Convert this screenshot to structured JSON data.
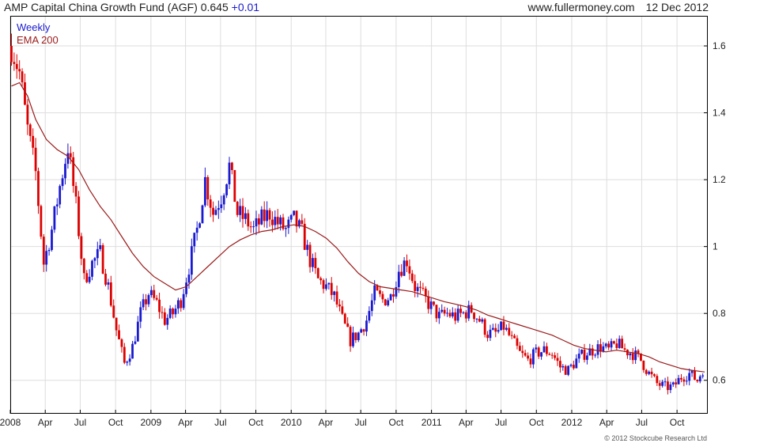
{
  "header": {
    "title": "AMP Capital China Growth Fund (AGF) 0.645",
    "change": "+0.01",
    "site": "www.fullermoney.com",
    "date": "12 Dec 2012"
  },
  "credit": "© 2012 Stockcube Research Ltd",
  "colors": {
    "up": "#1a1ad0",
    "down": "#dd0000",
    "ema": "#9a1a1a",
    "grid": "#dddddd",
    "axis": "#000000"
  },
  "chart_data": {
    "type": "candlestick",
    "frequency": "Weekly",
    "legend": [
      "Weekly",
      "EMA 200"
    ],
    "legend_position": "top-left",
    "grid": true,
    "x_ticks": [
      "2008",
      "Apr",
      "Jul",
      "Oct",
      "2009",
      "Apr",
      "Jul",
      "Oct",
      "2010",
      "Apr",
      "Jul",
      "Oct",
      "2011",
      "Apr",
      "Jul",
      "Oct",
      "2012",
      "Apr",
      "Jul",
      "Oct"
    ],
    "y_ticks": [
      "0.6",
      "0.8",
      "1",
      "1.2",
      "1.4",
      "1.6"
    ],
    "y_axis_side": "right",
    "ylim": [
      0.5,
      1.69
    ],
    "xlim": [
      "2008-01-01",
      "2012-12-20"
    ],
    "series": [
      {
        "name": "Weekly",
        "values": [
          [
            "2008-01-04",
            1.6
          ],
          [
            "2008-01-25",
            1.52
          ],
          [
            "2008-02-15",
            1.35
          ],
          [
            "2008-03-07",
            1.22
          ],
          [
            "2008-03-28",
            0.95
          ],
          [
            "2008-04-18",
            1.05
          ],
          [
            "2008-05-09",
            1.18
          ],
          [
            "2008-05-30",
            1.3
          ],
          [
            "2008-06-20",
            1.12
          ],
          [
            "2008-07-11",
            0.9
          ],
          [
            "2008-08-01",
            0.95
          ],
          [
            "2008-08-22",
            0.98
          ],
          [
            "2008-09-12",
            0.88
          ],
          [
            "2008-10-03",
            0.75
          ],
          [
            "2008-10-24",
            0.65
          ],
          [
            "2008-11-14",
            0.7
          ],
          [
            "2008-12-05",
            0.8
          ],
          [
            "2008-12-26",
            0.86
          ],
          [
            "2009-01-16",
            0.83
          ],
          [
            "2009-02-06",
            0.78
          ],
          [
            "2009-02-27",
            0.8
          ],
          [
            "2009-03-20",
            0.84
          ],
          [
            "2009-04-10",
            0.94
          ],
          [
            "2009-05-01",
            1.05
          ],
          [
            "2009-05-22",
            1.2
          ],
          [
            "2009-06-12",
            1.1
          ],
          [
            "2009-07-03",
            1.15
          ],
          [
            "2009-07-24",
            1.24
          ],
          [
            "2009-08-14",
            1.1
          ],
          [
            "2009-09-04",
            1.08
          ],
          [
            "2009-09-25",
            1.05
          ],
          [
            "2009-10-16",
            1.08
          ],
          [
            "2009-11-06",
            1.1
          ],
          [
            "2009-11-27",
            1.07
          ],
          [
            "2009-12-18",
            1.05
          ],
          [
            "2010-01-08",
            1.08
          ],
          [
            "2010-01-29",
            1.04
          ],
          [
            "2010-02-19",
            0.96
          ],
          [
            "2010-03-12",
            0.9
          ],
          [
            "2010-04-02",
            0.88
          ],
          [
            "2010-04-23",
            0.85
          ],
          [
            "2010-05-14",
            0.78
          ],
          [
            "2010-06-04",
            0.72
          ],
          [
            "2010-06-25",
            0.74
          ],
          [
            "2010-07-16",
            0.78
          ],
          [
            "2010-08-06",
            0.86
          ],
          [
            "2010-08-27",
            0.84
          ],
          [
            "2010-09-17",
            0.85
          ],
          [
            "2010-10-08",
            0.93
          ],
          [
            "2010-10-29",
            0.96
          ],
          [
            "2010-11-19",
            0.88
          ],
          [
            "2010-12-10",
            0.85
          ],
          [
            "2010-12-31",
            0.82
          ],
          [
            "2011-01-21",
            0.79
          ],
          [
            "2011-02-11",
            0.8
          ],
          [
            "2011-03-04",
            0.79
          ],
          [
            "2011-03-25",
            0.8
          ],
          [
            "2011-04-15",
            0.81
          ],
          [
            "2011-05-06",
            0.78
          ],
          [
            "2011-05-27",
            0.74
          ],
          [
            "2011-06-17",
            0.74
          ],
          [
            "2011-07-08",
            0.76
          ],
          [
            "2011-07-29",
            0.72
          ],
          [
            "2011-08-19",
            0.68
          ],
          [
            "2011-09-09",
            0.66
          ],
          [
            "2011-09-30",
            0.68
          ],
          [
            "2011-10-21",
            0.69
          ],
          [
            "2011-11-11",
            0.68
          ],
          [
            "2011-12-02",
            0.64
          ],
          [
            "2011-12-23",
            0.63
          ],
          [
            "2012-01-13",
            0.66
          ],
          [
            "2012-02-03",
            0.68
          ],
          [
            "2012-02-24",
            0.69
          ],
          [
            "2012-03-16",
            0.7
          ],
          [
            "2012-04-06",
            0.69
          ],
          [
            "2012-04-27",
            0.71
          ],
          [
            "2012-05-18",
            0.69
          ],
          [
            "2012-06-08",
            0.68
          ],
          [
            "2012-06-29",
            0.66
          ],
          [
            "2012-07-20",
            0.62
          ],
          [
            "2012-08-10",
            0.59
          ],
          [
            "2012-08-31",
            0.58
          ],
          [
            "2012-09-21",
            0.58
          ],
          [
            "2012-10-12",
            0.61
          ],
          [
            "2012-11-02",
            0.62
          ],
          [
            "2012-11-23",
            0.6
          ],
          [
            "2012-12-12",
            0.645
          ]
        ]
      },
      {
        "name": "EMA 200",
        "values": [
          [
            "2008-01-04",
            1.48
          ],
          [
            "2008-01-25",
            1.49
          ],
          [
            "2008-02-15",
            1.45
          ],
          [
            "2008-03-07",
            1.38
          ],
          [
            "2008-04-04",
            1.32
          ],
          [
            "2008-05-02",
            1.29
          ],
          [
            "2008-05-30",
            1.27
          ],
          [
            "2008-06-27",
            1.23
          ],
          [
            "2008-07-25",
            1.17
          ],
          [
            "2008-08-22",
            1.12
          ],
          [
            "2008-09-19",
            1.08
          ],
          [
            "2008-10-17",
            1.03
          ],
          [
            "2008-11-14",
            0.98
          ],
          [
            "2008-12-12",
            0.94
          ],
          [
            "2009-01-09",
            0.91
          ],
          [
            "2009-02-06",
            0.89
          ],
          [
            "2009-03-06",
            0.87
          ],
          [
            "2009-04-03",
            0.88
          ],
          [
            "2009-05-01",
            0.91
          ],
          [
            "2009-05-29",
            0.94
          ],
          [
            "2009-06-26",
            0.97
          ],
          [
            "2009-07-24",
            1.0
          ],
          [
            "2009-08-21",
            1.02
          ],
          [
            "2009-09-18",
            1.035
          ],
          [
            "2009-10-16",
            1.045
          ],
          [
            "2009-11-13",
            1.05
          ],
          [
            "2009-12-11",
            1.06
          ],
          [
            "2010-01-08",
            1.065
          ],
          [
            "2010-02-05",
            1.06
          ],
          [
            "2010-03-05",
            1.045
          ],
          [
            "2010-04-02",
            1.025
          ],
          [
            "2010-04-30",
            0.995
          ],
          [
            "2010-05-28",
            0.955
          ],
          [
            "2010-06-25",
            0.92
          ],
          [
            "2010-07-23",
            0.895
          ],
          [
            "2010-08-20",
            0.88
          ],
          [
            "2010-09-17",
            0.875
          ],
          [
            "2010-10-15",
            0.87
          ],
          [
            "2010-11-12",
            0.865
          ],
          [
            "2010-12-10",
            0.855
          ],
          [
            "2011-01-07",
            0.845
          ],
          [
            "2011-02-04",
            0.835
          ],
          [
            "2011-03-04",
            0.828
          ],
          [
            "2011-04-01",
            0.82
          ],
          [
            "2011-04-29",
            0.81
          ],
          [
            "2011-05-27",
            0.795
          ],
          [
            "2011-06-24",
            0.785
          ],
          [
            "2011-07-22",
            0.775
          ],
          [
            "2011-08-19",
            0.765
          ],
          [
            "2011-09-16",
            0.755
          ],
          [
            "2011-10-14",
            0.745
          ],
          [
            "2011-11-11",
            0.735
          ],
          [
            "2011-12-09",
            0.72
          ],
          [
            "2012-01-06",
            0.705
          ],
          [
            "2012-02-03",
            0.695
          ],
          [
            "2012-03-02",
            0.69
          ],
          [
            "2012-03-30",
            0.685
          ],
          [
            "2012-04-27",
            0.69
          ],
          [
            "2012-05-25",
            0.685
          ],
          [
            "2012-06-22",
            0.68
          ],
          [
            "2012-07-20",
            0.67
          ],
          [
            "2012-08-17",
            0.655
          ],
          [
            "2012-09-14",
            0.645
          ],
          [
            "2012-10-12",
            0.635
          ],
          [
            "2012-11-09",
            0.63
          ],
          [
            "2012-12-12",
            0.625
          ]
        ]
      }
    ]
  }
}
